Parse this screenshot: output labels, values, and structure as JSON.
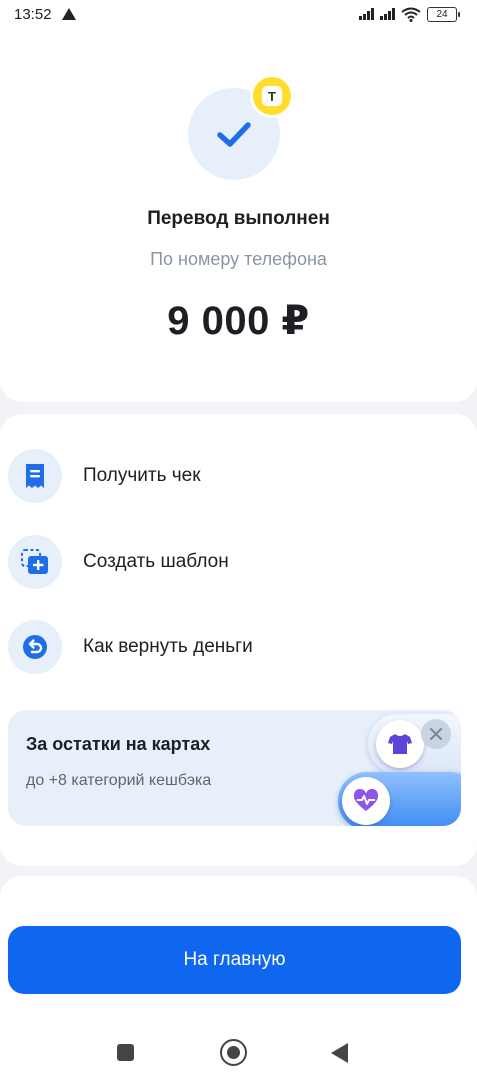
{
  "status_bar": {
    "time": "13:52",
    "battery": "24",
    "icons": [
      "warning-icon",
      "signal-icon",
      "signal-icon",
      "wifi-icon",
      "battery-icon"
    ]
  },
  "result": {
    "title": "Перевод выполнен",
    "subtitle": "По номеру телефона",
    "amount": "9 000 ₽",
    "badge_letter": "T",
    "icon": "checkmark-icon"
  },
  "actions": [
    {
      "label": "Получить чек",
      "icon": "receipt-icon"
    },
    {
      "label": "Создать шаблон",
      "icon": "template-icon"
    },
    {
      "label": "Как вернуть деньги",
      "icon": "return-money-icon"
    }
  ],
  "promo": {
    "title": "За остатки на картах",
    "subtitle": "до +8 категорий кешбэка",
    "icons": [
      "tshirt-icon",
      "heart-pulse-icon",
      "close-icon"
    ]
  },
  "footer": {
    "home_button": "На главную"
  },
  "colors": {
    "accent": "#0e67ee",
    "icon_bg": "#e7effb",
    "badge": "#ffdd2d",
    "secondary_text": "#8a94a6"
  }
}
